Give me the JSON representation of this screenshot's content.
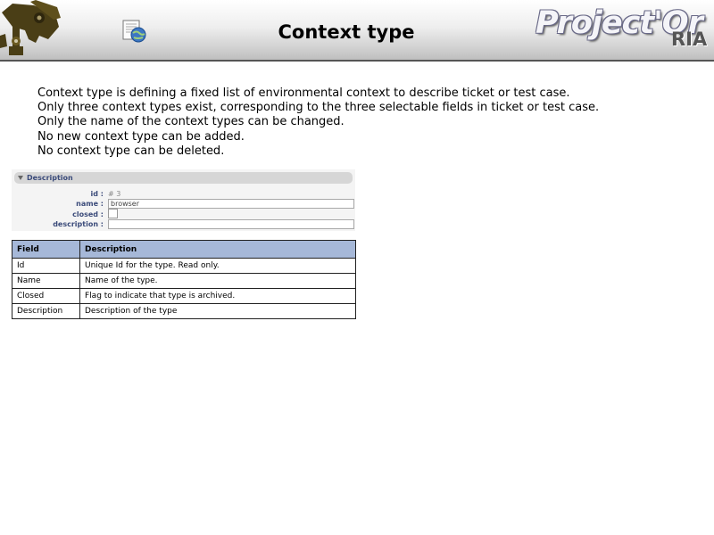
{
  "header": {
    "title": "Context type",
    "brand_main": "Project'Or",
    "brand_sub": "RIA"
  },
  "intro": [
    "Context type is defining a fixed list of environmental context to describe ticket or test case.",
    "Only three context types exist, corresponding to the three selectable fields in ticket or test case.",
    "Only the name of the context types can be changed.",
    "No new context type can be added.",
    "No context type can be deleted."
  ],
  "form": {
    "section_label": "Description",
    "id_label": "id :",
    "id_value": "# 3",
    "name_label": "name :",
    "name_value": "browser",
    "closed_label": "closed :",
    "description_label": "description :",
    "description_value": ""
  },
  "table": {
    "headers": [
      "Field",
      "Description"
    ],
    "rows": [
      [
        "Id",
        "Unique Id for the type. Read only."
      ],
      [
        "Name",
        "Name of the type."
      ],
      [
        "Closed",
        "Flag to indicate that type is archived."
      ],
      [
        "Description",
        "Description of the type"
      ]
    ]
  },
  "colors": {
    "table_header": "#a6b8d8",
    "form_label": "#3b4b7a"
  },
  "icons": {
    "logo": "surveillance-camera-logo-icon",
    "help": "help-document-globe-icon"
  }
}
